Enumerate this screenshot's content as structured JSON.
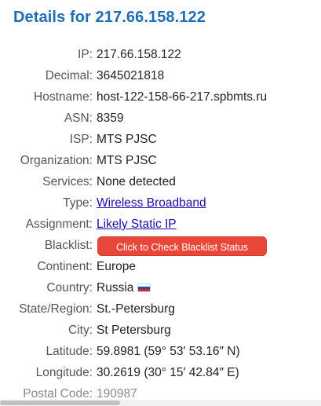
{
  "page": {
    "title": "Details for 217.66.158.122"
  },
  "details": {
    "ip": {
      "label": "IP:",
      "value": "217.66.158.122"
    },
    "decimal": {
      "label": "Decimal:",
      "value": "3645021818"
    },
    "hostname": {
      "label": "Hostname:",
      "value": "host-122-158-66-217.spbmts.ru"
    },
    "asn": {
      "label": "ASN:",
      "value": "8359"
    },
    "isp": {
      "label": "ISP:",
      "value": "MTS PJSC"
    },
    "organization": {
      "label": "Organization:",
      "value": "MTS PJSC"
    },
    "services": {
      "label": "Services:",
      "value": "None detected"
    },
    "type": {
      "label": "Type:",
      "value": "Wireless Broadband"
    },
    "assignment": {
      "label": "Assignment:",
      "value": "Likely Static IP"
    },
    "blacklist": {
      "label": "Blacklist:",
      "button_label": "Click to Check Blacklist Status"
    },
    "continent": {
      "label": "Continent:",
      "value": "Europe"
    },
    "country": {
      "label": "Country:",
      "value": "Russia",
      "flag_icon": "russia-flag-icon"
    },
    "state_region": {
      "label": "State/Region:",
      "value": "St.-Petersburg"
    },
    "city": {
      "label": "City:",
      "value": "St Petersburg"
    },
    "latitude": {
      "label": "Latitude:",
      "value": "59.8981  (59° 53′ 53.16″ N)"
    },
    "longitude": {
      "label": "Longitude:",
      "value": "30.2619  (30° 15′ 42.84″ E)"
    },
    "postal_code": {
      "label": "Postal Code:",
      "value": "190987"
    }
  },
  "colors": {
    "title": "#1f6eb5",
    "link": "#1a0dab",
    "blacklist_button": "#e8473a",
    "label": "#555555"
  }
}
